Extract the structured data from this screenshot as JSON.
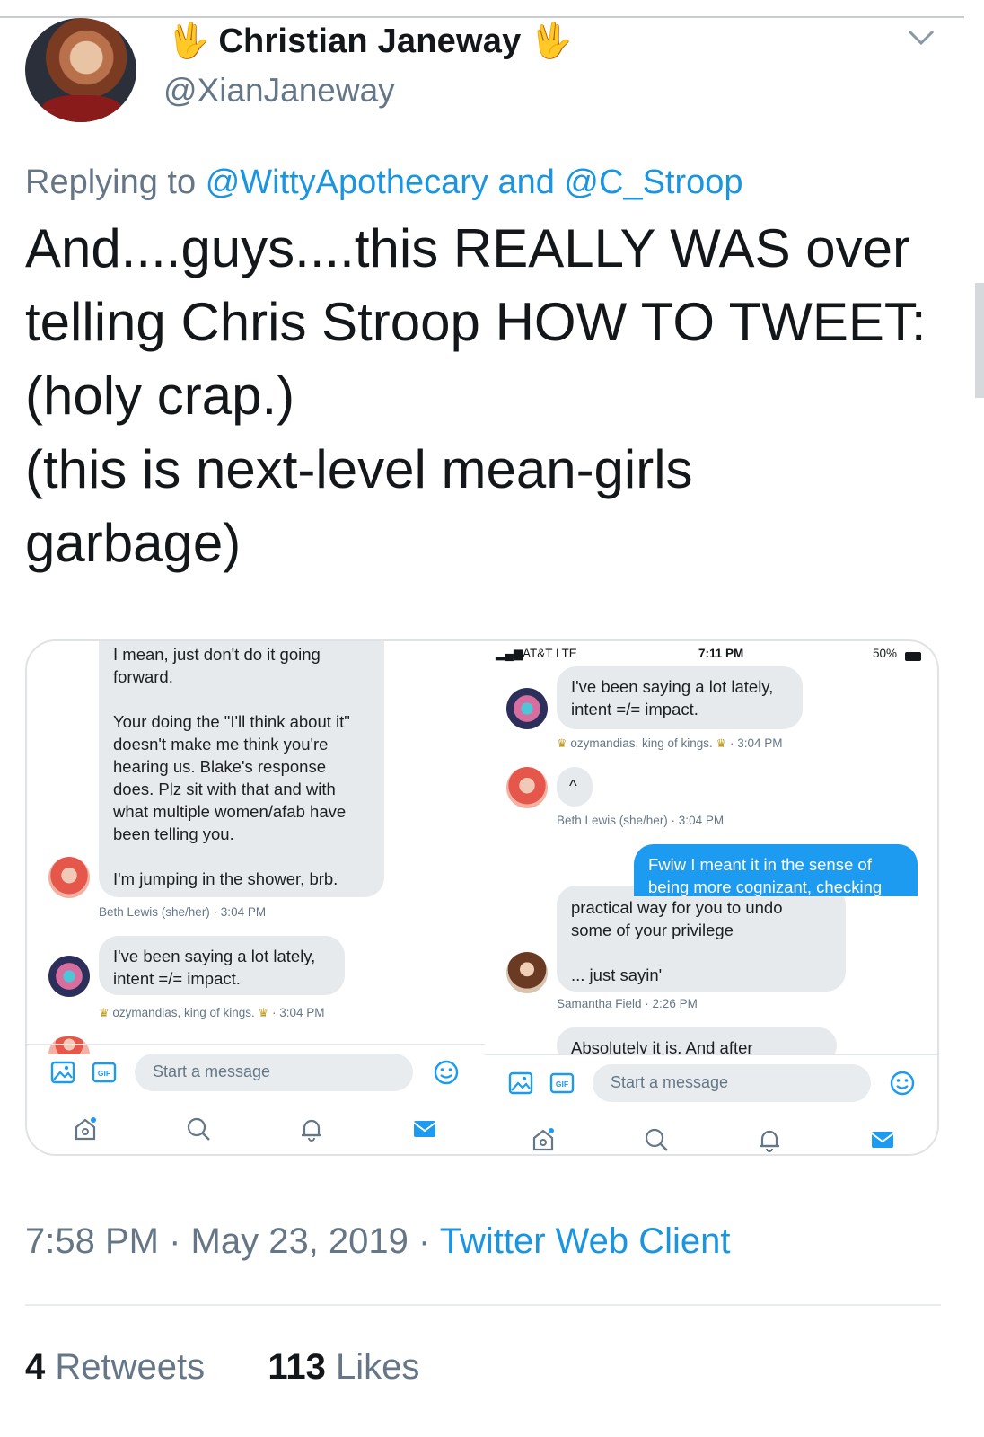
{
  "author": {
    "name_emoji": "🖖",
    "display_name": "Christian Janeway",
    "handle": "@XianJaneway"
  },
  "reply": {
    "prefix": "Replying to",
    "mentions": "@WittyApothecary and @C_Stroop"
  },
  "tweet": {
    "lines": [
      "And....guys....this REALLY WAS over",
      "telling Chris Stroop HOW TO TWEET:",
      "(holy crap.)",
      "(this is next-level mean-girls",
      "garbage)"
    ]
  },
  "left_panel": {
    "bubble1": {
      "p1": "I mean, just don't do it going forward.",
      "p2": "Your doing the \"I'll think about it\" doesn't make me think you're hearing us. Blake's response does. Plz sit with that and with what multiple women/afab have been telling you.",
      "p3": "I'm jumping in the shower, brb."
    },
    "meta1": "Beth Lewis (she/her) · 3:04 PM",
    "bubble2": "I've been saying a lot lately, intent =/= impact.",
    "meta2": "ozymandias, king of kings.",
    "meta2_time": "· 3:04 PM",
    "compose_placeholder": "Start a message"
  },
  "right_panel": {
    "status": {
      "carrier": "AT&T  LTE",
      "time": "7:11 PM",
      "battery": "50%"
    },
    "bubble1": "I've been saying a lot lately, intent =/= impact.",
    "meta1": "ozymandias, king of kings.",
    "meta1_time": "· 3:04 PM",
    "bubble2": "^",
    "meta2": "Beth Lewis (she/her) · 3:04 PM",
    "blue_bubble": "Fwiw I meant it in the sense of being more cognizant, checking",
    "bubble3_top": "practical way for you to undo",
    "bubble3_p1": "some of your privilege",
    "bubble3_p2": "... just sayin'",
    "meta3": "Samantha Field · 2:26 PM",
    "bubble4": "Absolutely it is. And after",
    "compose_placeholder": "Start a message"
  },
  "footer": {
    "time": "7:58 PM · May 23, 2019 · ",
    "client": "Twitter Web Client",
    "retweets_count": "4",
    "retweets_label": "Retweets",
    "likes_count": "113",
    "likes_label": "Likes"
  },
  "icons": [
    "chevron-down-icon",
    "image-icon",
    "gif-icon",
    "emoji-icon",
    "home-icon",
    "search-icon",
    "bell-icon",
    "mail-icon"
  ],
  "colors": {
    "link": "#1b95e0",
    "secondary_text": "#657786",
    "dm_blue": "#1d9bf0"
  }
}
